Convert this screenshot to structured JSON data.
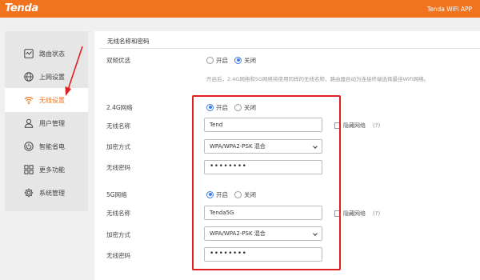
{
  "header": {
    "logo": "Tenda",
    "app_link": "Tenda WiFi APP",
    "bg_color": "#f0731e"
  },
  "sidebar": {
    "items": [
      {
        "label": "路由状态",
        "icon": "chart-icon",
        "active": false
      },
      {
        "label": "上网设置",
        "icon": "globe-icon",
        "active": false
      },
      {
        "label": "无线设置",
        "icon": "wifi-icon",
        "active": true
      },
      {
        "label": "用户管理",
        "icon": "user-icon",
        "active": false
      },
      {
        "label": "智能省电",
        "icon": "power-icon",
        "active": false
      },
      {
        "label": "更多功能",
        "icon": "grid-icon",
        "active": false
      },
      {
        "label": "系统管理",
        "icon": "gear-icon",
        "active": false
      }
    ]
  },
  "main": {
    "section_title": "无线名称和密码",
    "dual_band": {
      "label": "双频优选",
      "options": [
        "开启",
        "关闭"
      ],
      "selected": "关闭",
      "hint": "开启后，2.4G网络和5G网络将使用同样的无线名称，路由器自动为连接终端选择最佳WiFi网络。"
    },
    "band_24g": {
      "label": "2.4G网络",
      "options": [
        "开启",
        "关闭"
      ],
      "selected": "开启",
      "ssid_label": "无线名称",
      "ssid_value": "Tend",
      "hide_label": "隐藏网络",
      "help": "(?)",
      "security_label": "加密方式",
      "security_value": "WPA/WPA2-PSK 混合",
      "password_label": "无线密码",
      "password_value": "••••••••"
    },
    "band_5g": {
      "label": "5G网络",
      "options": [
        "开启",
        "关闭"
      ],
      "selected": "开启",
      "ssid_label": "无线名称",
      "ssid_value": "Tenda5G",
      "hide_label": "隐藏网络",
      "help": "(?)",
      "security_label": "加密方式",
      "security_value": "WPA/WPA2-PSK 混合",
      "password_label": "无线密码",
      "password_value": "••••••••"
    }
  },
  "colors": {
    "accent": "#f0731e",
    "radio_active": "#3b7de0",
    "annotation": "#e02020"
  }
}
